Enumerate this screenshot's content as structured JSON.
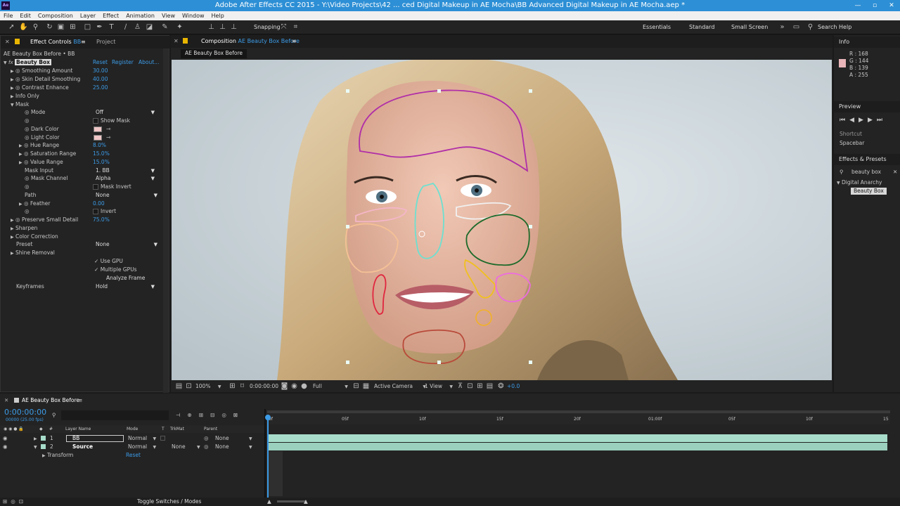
{
  "title_bar": {
    "logo": "Ae",
    "title": "Adobe After Effects CC 2015 - Y:\\Video Projects\\42 ... ced Digital Makeup in AE Mocha\\BB Advanced Digital Makeup in AE Mocha.aep *"
  },
  "menu": [
    "File",
    "Edit",
    "Composition",
    "Layer",
    "Effect",
    "Animation",
    "View",
    "Window",
    "Help"
  ],
  "toolbar": {
    "snapping_label": "Snapping",
    "workspaces": [
      "Essentials",
      "Standard",
      "Small Screen"
    ],
    "search_help": "Search Help"
  },
  "effect_controls": {
    "tab_label": "Effect Controls",
    "tab_layer": "BB",
    "project_tab": "Project",
    "breadcrumb": "AE Beauty Box Before • BB",
    "effect_fx": "fx",
    "effect_name": "Beauty Box",
    "reset": "Reset",
    "register": "Register",
    "about": "About...",
    "rows": {
      "smoothing_amount": {
        "label": "Smoothing Amount",
        "value": "30.00"
      },
      "skin_detail": {
        "label": "Skin Detail Smoothing",
        "value": "40.00"
      },
      "contrast": {
        "label": "Contrast Enhance",
        "value": "25.00"
      },
      "info_only": "Info Only",
      "mask": "Mask",
      "mode": {
        "label": "Mode",
        "value": "Off"
      },
      "show_mask": "Show Mask",
      "dark_color": "Dark Color",
      "light_color": "Light Color",
      "hue_range": {
        "label": "Hue Range",
        "value": "8.0%"
      },
      "saturation_range": {
        "label": "Saturation Range",
        "value": "15.0%"
      },
      "value_range": {
        "label": "Value Range",
        "value": "15.0%"
      },
      "mask_input": {
        "label": "Mask Input",
        "value": "1. BB"
      },
      "mask_channel": {
        "label": "Mask Channel",
        "value": "Alpha"
      },
      "mask_invert": "Mask Invert",
      "path": {
        "label": "Path",
        "value": "None"
      },
      "feather": {
        "label": "Feather",
        "value": "0.00"
      },
      "invert": "Invert",
      "preserve": {
        "label": "Preserve Small Detail",
        "value": "75.0%"
      },
      "sharpen": "Sharpen",
      "color_correction": "Color Correction",
      "preset": {
        "label": "Preset",
        "value": "None"
      },
      "shine_removal": "Shine Removal",
      "use_gpu": "Use GPU",
      "multiple_gpus": "Multiple GPUs",
      "analyze_frame": "Analyze Frame",
      "keyframes": {
        "label": "Keyframes",
        "value": "Hold"
      },
      "check_mark": "✓"
    }
  },
  "composition": {
    "tab_label": "Composition",
    "tab_comp": "AE Beauty Box Before",
    "sub_tab": "AE Beauty Box Before",
    "viewer_bar": {
      "zoom": "100%",
      "timecode": "0:00:00:00",
      "resolution": "Full",
      "camera": "Active Camera",
      "view": "1 View",
      "exposure": "+0.0"
    }
  },
  "info_panel": {
    "title": "Info",
    "r": "R : 168",
    "g": "G : 144",
    "b": "B : 139",
    "a": "A : 255",
    "sample_color": "#e8b4b8"
  },
  "preview_panel": {
    "title": "Preview",
    "shortcut_label": "Shortcut",
    "shortcut_value": "Spacebar"
  },
  "effects_presets": {
    "title": "Effects & Presets",
    "search": "beauty box",
    "category": "Digital Anarchy",
    "item": "Beauty Box"
  },
  "timeline": {
    "comp_tab": "AE Beauty Box Before",
    "timecode": "0:00:00:00",
    "fps": "00000 (25.00 fps)",
    "columns": {
      "num": "#",
      "layer_name": "Layer Name",
      "mode": "Mode",
      "t": "T",
      "trkmat": "TrkMat",
      "parent": "Parent"
    },
    "layers": [
      {
        "num": "1",
        "name": "BB",
        "mode": "Normal",
        "trkmat": "",
        "parent": "None"
      },
      {
        "num": "2",
        "name": "Source",
        "mode": "Normal",
        "trkmat": "None",
        "parent": "None"
      }
    ],
    "transform": {
      "label": "Transform",
      "reset": "Reset"
    },
    "ruler": [
      "0f",
      "05f",
      "10f",
      "15f",
      "20f",
      "01:00f",
      "05f",
      "10f",
      "15"
    ],
    "toggle": "Toggle Switches / Modes"
  },
  "colors": {
    "accent": "#3c9be6",
    "title_bar": "#2d8fd5",
    "layer_bar": "#a7dcca"
  }
}
